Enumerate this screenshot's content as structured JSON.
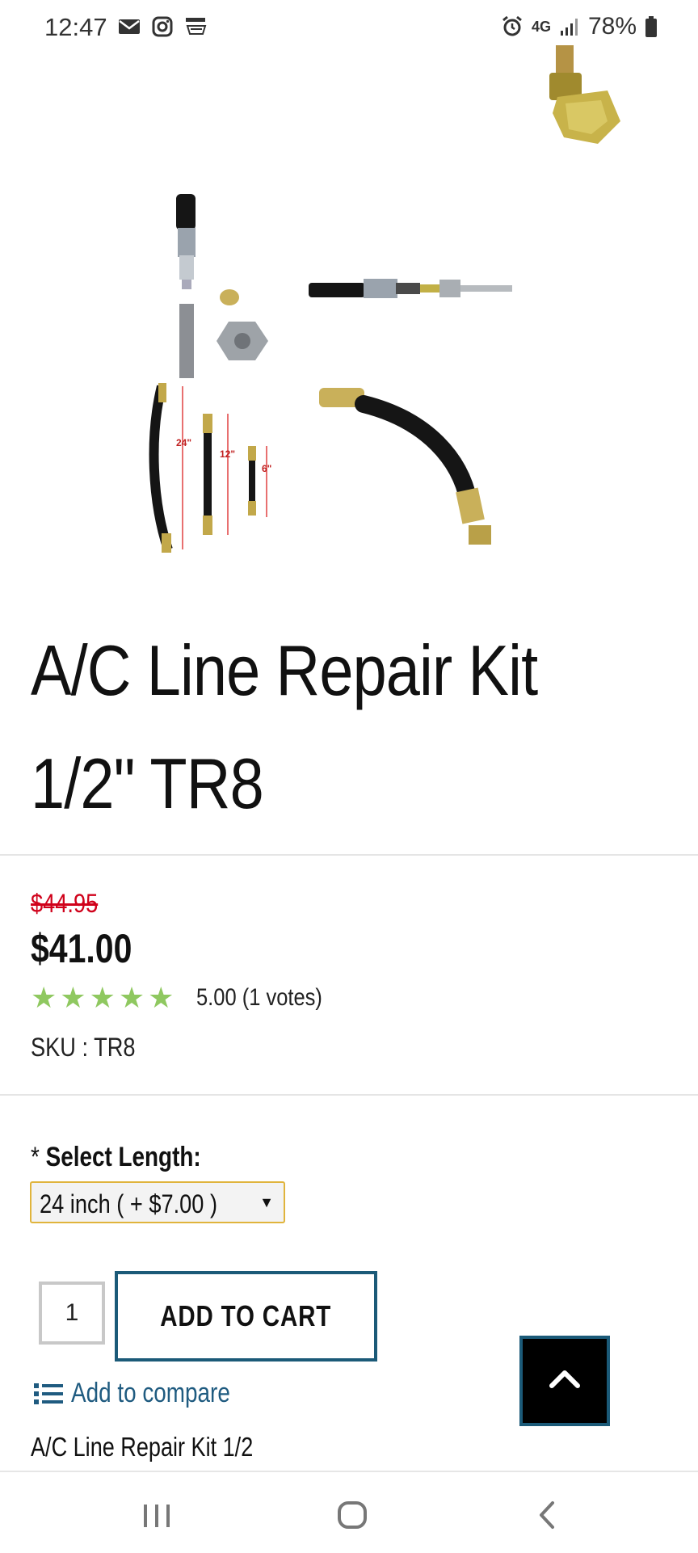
{
  "status_bar": {
    "time": "12:47",
    "network": "4G",
    "battery": "78%"
  },
  "product": {
    "title": "A/C Line Repair Kit 1/2\" TR8",
    "old_price": "$44.95",
    "price": "$41.00",
    "rating_stars": 5,
    "rating_text": "5.00 (1 votes)",
    "sku": "SKU : TR8",
    "image_labels": [
      "24\"",
      "12\"",
      "6\""
    ],
    "description": "A/C Line Repair Kit 1/2"
  },
  "options": {
    "required_mark": "*",
    "label": "Select Length:",
    "selected": "24 inch ( + $7.00 )"
  },
  "cart": {
    "quantity": "1",
    "add_label": "ADD TO CART"
  },
  "compare": {
    "label": "Add to compare"
  },
  "colors": {
    "old_price": "#d0021b",
    "star": "#8fc860",
    "accent": "#1b5a78",
    "select_border": "#e0b43c",
    "link": "#1f5b80"
  }
}
